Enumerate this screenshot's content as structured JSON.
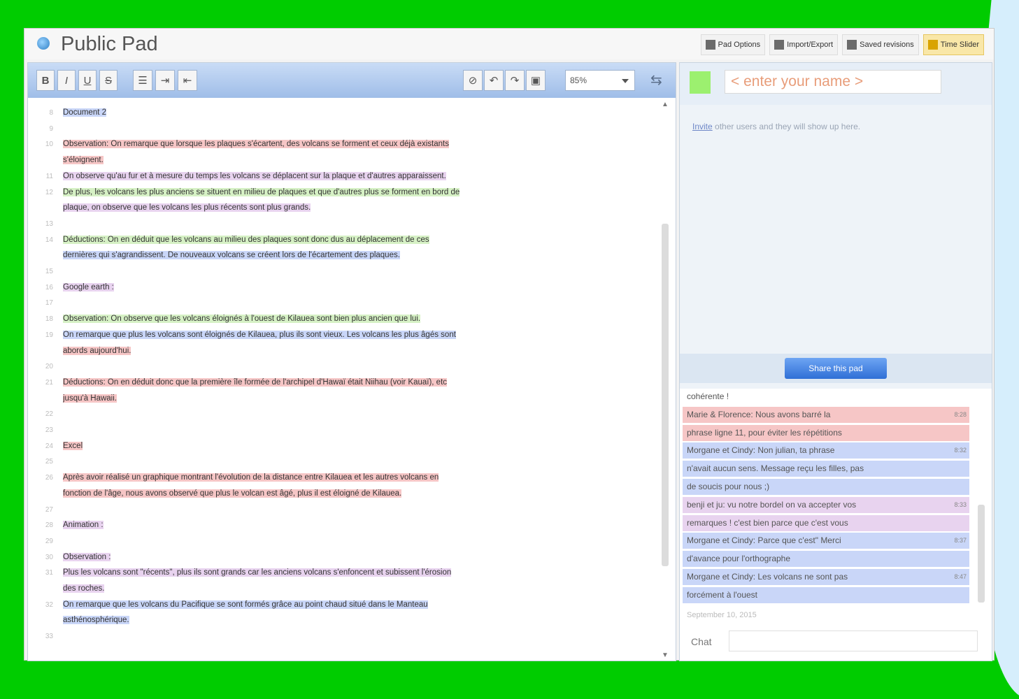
{
  "app": {
    "title": "Public Pad"
  },
  "top_menu": [
    {
      "label": "Pad Options",
      "icon": "options-icon"
    },
    {
      "label": "Import/Export",
      "icon": "import-export-icon"
    },
    {
      "label": "Saved revisions",
      "icon": "save-icon"
    },
    {
      "label": "Time Slider",
      "icon": "time-slider-icon"
    }
  ],
  "toolbar": {
    "bold": "B",
    "italic": "I",
    "underline": "U",
    "strike": "S",
    "zoom": "85%"
  },
  "editor_lines": [
    {
      "n": "8",
      "text": "Document 2",
      "c": "b"
    },
    {
      "n": "9",
      "text": "",
      "c": ""
    },
    {
      "n": "10",
      "text": "Observation: On remarque que lorsque les plaques s'écartent, des volcans se forment et ceux déjà existants",
      "c": "r"
    },
    {
      "n": "",
      "text": "s'éloignent.",
      "c": "r"
    },
    {
      "n": "11",
      "text": "On observe qu'au fur et à mesure du temps les volcans se déplacent sur la plaque et d'autres apparaissent.",
      "c": "p"
    },
    {
      "n": "12",
      "text": "De plus, les volcans les plus anciens se situent en milieu de plaques et que d'autres plus se forment en bord de",
      "c": "g"
    },
    {
      "n": "",
      "text": "plaque, on observe que les volcans les plus récents sont plus grands.",
      "c": "p"
    },
    {
      "n": "13",
      "text": "",
      "c": ""
    },
    {
      "n": "14",
      "text": "Déductions: On en déduit que les volcans au milieu des plaques sont donc dus au déplacement de ces",
      "c": "g"
    },
    {
      "n": "",
      "text": "dernières qui s'agrandissent. De nouveaux volcans se créent lors de l'écartement des plaques.",
      "c": "b"
    },
    {
      "n": "15",
      "text": "",
      "c": ""
    },
    {
      "n": "16",
      "text": "Google earth :",
      "c": "p"
    },
    {
      "n": "17",
      "text": "",
      "c": ""
    },
    {
      "n": "18",
      "text": "Observation: On observe que les volcans éloignés à l'ouest de Kilauea sont bien plus ancien que lui.",
      "c": "g"
    },
    {
      "n": "19",
      "text": "On remarque que plus les volcans sont éloignés de Kilauea, plus ils sont vieux. Les volcans les plus âgés sont",
      "c": "b"
    },
    {
      "n": "",
      "text": "abords aujourd'hui.",
      "c": "r"
    },
    {
      "n": "20",
      "text": "",
      "c": ""
    },
    {
      "n": "21",
      "text": "Déductions: On en déduit donc que la première île formée de l'archipel d'Hawaï était Niihau (voir Kauaï), etc",
      "c": "r"
    },
    {
      "n": "",
      "text": "jusqu'à Hawaii.",
      "c": "r"
    },
    {
      "n": "22",
      "text": "",
      "c": ""
    },
    {
      "n": "23",
      "text": "",
      "c": ""
    },
    {
      "n": "24",
      "text": "Excel",
      "c": "r"
    },
    {
      "n": "25",
      "text": "",
      "c": ""
    },
    {
      "n": "26",
      "text": "Après avoir réalisé un graphique montrant l'évolution de la distance entre Kilauea et les autres volcans en",
      "c": "r"
    },
    {
      "n": "",
      "text": "fonction de l'âge, nous avons observé que plus le volcan est âgé, plus il est éloigné de Kilauea.",
      "c": "r"
    },
    {
      "n": "27",
      "text": "",
      "c": ""
    },
    {
      "n": "28",
      "text": "Animation :",
      "c": "p"
    },
    {
      "n": "29",
      "text": "",
      "c": ""
    },
    {
      "n": "30",
      "text": "Observation :",
      "c": "p"
    },
    {
      "n": "31",
      "text": "Plus les volcans sont \"récents\", plus ils sont grands car les anciens volcans s'enfoncent et subissent l'érosion",
      "c": "p"
    },
    {
      "n": "",
      "text": "des roches.",
      "c": "p"
    },
    {
      "n": "32",
      "text": "On remarque que les volcans du Pacifique se sont formés grâce au point chaud situé dans le Manteau",
      "c": "b"
    },
    {
      "n": "",
      "text": "asthénosphérique.",
      "c": "b"
    },
    {
      "n": "33",
      "text": "",
      "c": ""
    }
  ],
  "users": {
    "name_placeholder": "< enter your name >",
    "invite_link": "Invite",
    "invite_text": " other users and they will show up here.",
    "share_label": "Share this pad"
  },
  "chat": {
    "messages": [
      {
        "text": "cohérente !",
        "time": "",
        "c": ""
      },
      {
        "text": "Marie & Florence: Nous avons barré la",
        "time": "8:28",
        "c": "r"
      },
      {
        "text": "phrase ligne 11, pour éviter les répétitions",
        "time": "",
        "c": "r"
      },
      {
        "text": "Morgane et Cindy: Non julian, ta phrase",
        "time": "8:32",
        "c": "b"
      },
      {
        "text": "n'avait aucun sens. Message reçu les filles, pas",
        "time": "",
        "c": "b"
      },
      {
        "text": "de soucis pour nous ;)",
        "time": "",
        "c": "b"
      },
      {
        "text": "benji et ju: vu notre bordel on va accepter vos",
        "time": "8:33",
        "c": "p"
      },
      {
        "text": "remarques ! c'est bien parce que c'est vous",
        "time": "",
        "c": "p"
      },
      {
        "text": "Morgane et Cindy: Parce que c'est\" Merci",
        "time": "8:37",
        "c": "b"
      },
      {
        "text": "d'avance pour l'orthographe",
        "time": "",
        "c": "b"
      },
      {
        "text": "Morgane et Cindy: Les volcans ne sont pas",
        "time": "8:47",
        "c": "b"
      },
      {
        "text": "forcément à l'ouest",
        "time": "",
        "c": "b"
      }
    ],
    "date": "September 10, 2015",
    "label": "Chat"
  }
}
